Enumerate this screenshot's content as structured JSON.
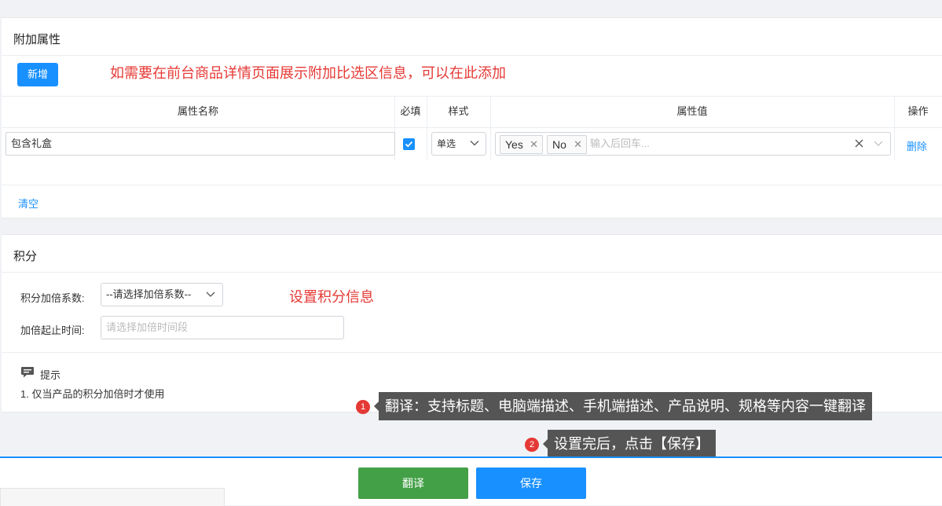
{
  "extra_attrs": {
    "title": "附加属性",
    "add_button": "新增",
    "annotation": "如需要在前台商品详情页面展示附加比选区信息，可以在此添加",
    "columns": [
      "属性名称",
      "必填",
      "样式",
      "属性值",
      "操作"
    ],
    "row": {
      "name": "包含礼盒",
      "required": true,
      "style": "单选",
      "tags": [
        "Yes",
        "No"
      ],
      "tags_placeholder": "输入后回车...",
      "delete": "删除"
    },
    "clear": "清空"
  },
  "points": {
    "title": "积分",
    "ratio_label": "积分加倍系数:",
    "ratio_value": "--请选择加倍系数--",
    "annotation": "设置积分信息",
    "time_label": "加倍起止时间:",
    "time_placeholder": "请选择加倍时间段",
    "tip_title": "提示",
    "tip_text": "1. 仅当产品的积分加倍时才使用"
  },
  "callouts": [
    {
      "num": "1",
      "text": "翻译：支持标题、电脑端描述、手机端描述、产品说明、规格等内容一键翻译"
    },
    {
      "num": "2",
      "text": "设置完后，点击【保存】"
    }
  ],
  "footer": {
    "translate": "翻译",
    "save": "保存"
  },
  "colors": {
    "primary": "#1890ff",
    "translate_btn": "#43a047",
    "annotation": "#e53935",
    "callout_bg": "#555555"
  }
}
